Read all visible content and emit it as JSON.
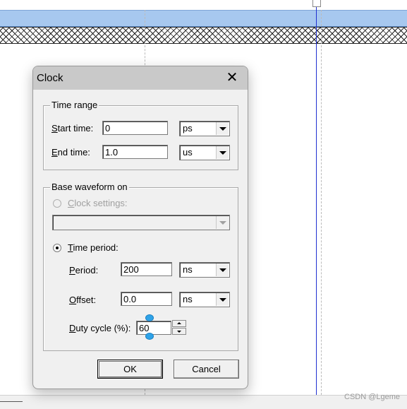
{
  "dialog": {
    "title": "Clock",
    "close_glyph": "✕",
    "time_range": {
      "legend": "Time range",
      "start_label_u": "S",
      "start_label_rest": "tart time:",
      "start_value": "0",
      "start_unit": "ps",
      "end_label_u": "E",
      "end_label_rest": "nd time:",
      "end_value": "1.0",
      "end_unit": "us"
    },
    "base_waveform": {
      "legend": "Base waveform on",
      "clock_settings_u": "C",
      "clock_settings_rest": "lock settings:",
      "clock_settings_value": "",
      "time_period_u": "T",
      "time_period_rest": "ime period:",
      "period_u": "P",
      "period_rest": "eriod:",
      "period_value": "200",
      "period_unit": "ns",
      "offset_u": "O",
      "offset_rest": "ffset:",
      "offset_value": "0.0",
      "offset_unit": "ns",
      "duty_u": "D",
      "duty_rest": "uty cycle (%):",
      "duty_value": "60"
    },
    "ok_label": "OK",
    "cancel_label": "Cancel"
  },
  "watermark": "CSDN @Lgeme",
  "colors": {
    "cursor_line": "#1f2fd1",
    "selection_handle": "#2fa3e8",
    "signal_bar": "#a7c8ef"
  }
}
